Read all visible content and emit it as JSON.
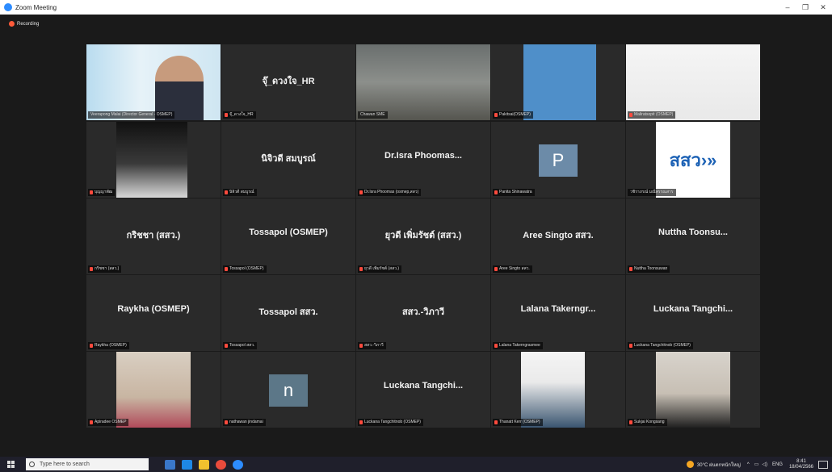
{
  "window": {
    "title": "Zoom Meeting",
    "controls": [
      "–",
      "❐",
      "✕"
    ]
  },
  "recording": {
    "label": "Recording"
  },
  "colors": {
    "active_border": "#b9d65b",
    "muted_mic": "#ff4a3d",
    "recording": "#ff5b3a",
    "tile_bg": "#2a2a2a"
  },
  "participants": [
    {
      "name": "Veerapong Malai (Director General - OSMEP)",
      "display": "",
      "kind": "video",
      "active": true,
      "muted": false
    },
    {
      "name": "จุ๊_ดวงใจ_HR",
      "display": "จุ๊_ดวงใจ_HR",
      "kind": "name",
      "muted": true
    },
    {
      "name": "Chawan SME",
      "display": "",
      "kind": "video",
      "muted": false
    },
    {
      "name": "Pakitsai(OSMEP)",
      "display": "",
      "kind": "video",
      "muted": true
    },
    {
      "name": "Maliratsopit (OSMEP)",
      "display": "",
      "kind": "video",
      "muted": true
    },
    {
      "name": "บุญญาพัฒ",
      "display": "",
      "kind": "video",
      "muted": true
    },
    {
      "name": "นิจิวดี สมบูรณ์",
      "display": "นิจิวดี สมบูรณ์",
      "kind": "name",
      "muted": true
    },
    {
      "name": "Dr.Isra Phoomas (osmep,สสว)",
      "display": "Dr.Isra  Phoomas...",
      "kind": "name",
      "muted": true
    },
    {
      "name": "Panita Shinawatra",
      "display": "P",
      "kind": "avatar",
      "muted": true
    },
    {
      "name": "วชิราภรณ์ มณีพรรณสาร",
      "display": "สสว",
      "kind": "logo",
      "muted": false
    },
    {
      "name": "กริชชา (สสว.)",
      "display": "กริชชา (สสว.)",
      "kind": "name",
      "muted": true
    },
    {
      "name": "Tossapol (OSMEP)",
      "display": "Tossapol (OSMEP)",
      "kind": "name",
      "muted": true
    },
    {
      "name": "ยุวดี เพิ่มรัชต์ (สสว.)",
      "display": "ยุวดี เพิ่มรัชต์ (สสว.)",
      "kind": "name",
      "muted": true
    },
    {
      "name": "Aree Singto สสว.",
      "display": "Aree Singto สสว.",
      "kind": "name",
      "muted": true
    },
    {
      "name": "Nuttha  Toonsuwan",
      "display": "Nuttha  Toonsu...",
      "kind": "name",
      "muted": true
    },
    {
      "name": "Raykha (OSMEP)",
      "display": "Raykha (OSMEP)",
      "kind": "name",
      "muted": true
    },
    {
      "name": "Tossapol สสว.",
      "display": "Tossapol สสว.",
      "kind": "name",
      "muted": true
    },
    {
      "name": "สสว.-วิภาวี",
      "display": "สสว.-วิภาวี",
      "kind": "name",
      "muted": true
    },
    {
      "name": "Lalana Takerngrasmee",
      "display": "Lalana  Takerngr...",
      "kind": "name",
      "muted": true
    },
    {
      "name": "Luckana Tangchitnob (OSMEP)",
      "display": "Luckana  Tangchi...",
      "kind": "name",
      "muted": true
    },
    {
      "name": "Apiradee  OSMEP",
      "display": "",
      "kind": "video",
      "muted": true
    },
    {
      "name": "nathawan jindamai",
      "display": "n",
      "kind": "avatar",
      "muted": true
    },
    {
      "name": "Luckana Tangchitnob (OSMEP)",
      "display": "Luckana  Tangchi...",
      "kind": "name",
      "muted": true
    },
    {
      "name": "Thanatt Kerr (OSMEP)",
      "display": "",
      "kind": "video",
      "muted": true
    },
    {
      "name": "Sukjai Kongsang",
      "display": "",
      "kind": "video",
      "muted": true
    }
  ],
  "taskbar": {
    "search_placeholder": "Type here to search",
    "weather": "30°C  ฝนตกหนักใหญ่",
    "lang": "ENG",
    "time": "8:41",
    "date": "18/04/2566",
    "apps": [
      "file-explorer",
      "mail",
      "store",
      "chrome",
      "zoom"
    ]
  }
}
